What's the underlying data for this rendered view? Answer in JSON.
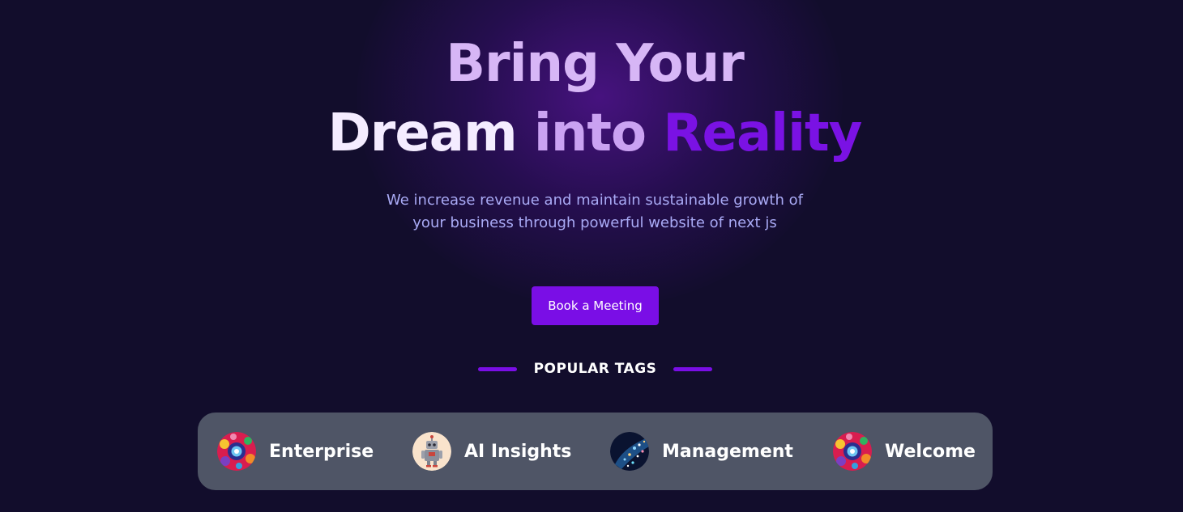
{
  "hero": {
    "title_line1": "Bring Your",
    "title_word_dream": "Dream",
    "title_word_into": "into",
    "title_word_reality": "Reality",
    "subtitle_line1": "We increase revenue and maintain sustainable growth of",
    "subtitle_line2": "your business through powerful website of next js"
  },
  "cta": {
    "label": "Book a Meeting"
  },
  "popular_tags": {
    "heading": "POPULAR TAGS",
    "items": [
      {
        "label": "Enterprise",
        "icon": "colorful-pattern-avatar-icon"
      },
      {
        "label": "AI Insights",
        "icon": "robot-avatar-icon"
      },
      {
        "label": "Management",
        "icon": "city-lights-avatar-icon"
      },
      {
        "label": "Welcome",
        "icon": "colorful-pattern-avatar-icon"
      }
    ]
  },
  "colors": {
    "background": "#120d2c",
    "accent": "#7a0ee6",
    "title_light": "#d7b6f6",
    "subtitle": "#a9aaf5",
    "panel": "#4f5566"
  }
}
